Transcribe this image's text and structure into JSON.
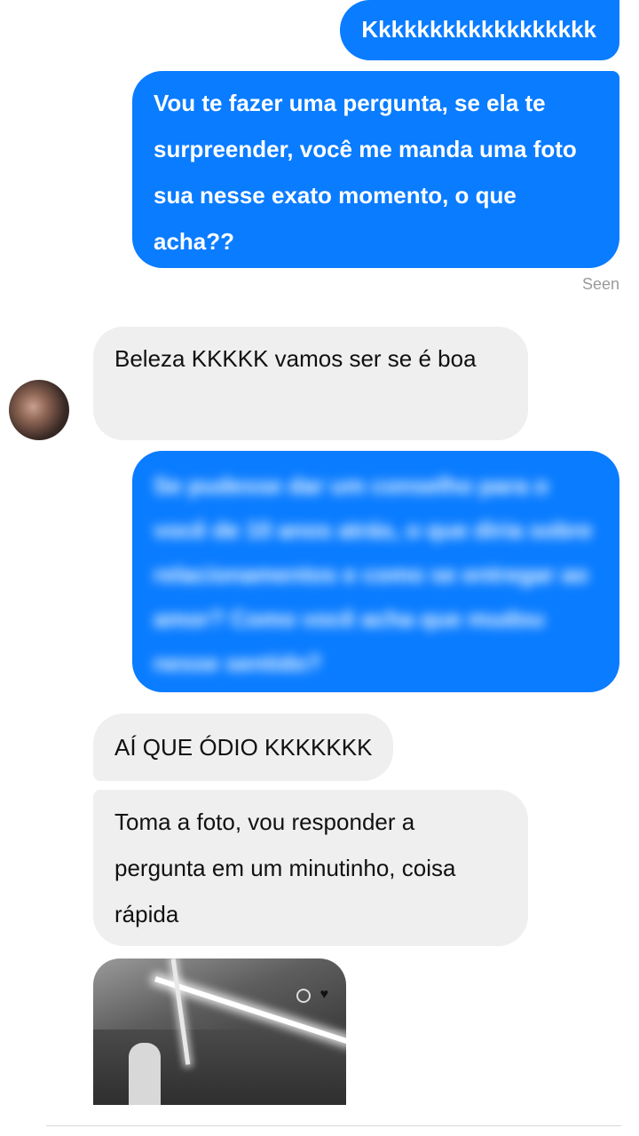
{
  "messages": {
    "m1": "Kkkkkkkkkkkkkkkkkk",
    "m2": "Vou te fazer uma pergunta, se ela te surpreender, você me manda uma foto sua nesse exato momento, o que acha??",
    "seen": "Seen",
    "m3": "Beleza KKKKK vamos ser se é boa",
    "m4": "Se pudesse dar um conselho para o você de 10 anos atrás, o que diria sobre relacionamentos e como se entregar ao amor? Como você acha que mudou nesse sentido?",
    "m5": "AÍ QUE ÓDIO KKKKKKK",
    "m6": "Toma a foto, vou responder a pergunta em um minutinho, coisa rápida"
  },
  "colors": {
    "outgoing_bubble": "#0a7cff",
    "incoming_bubble": "#efefef"
  },
  "icons": {
    "heart": "♥"
  }
}
